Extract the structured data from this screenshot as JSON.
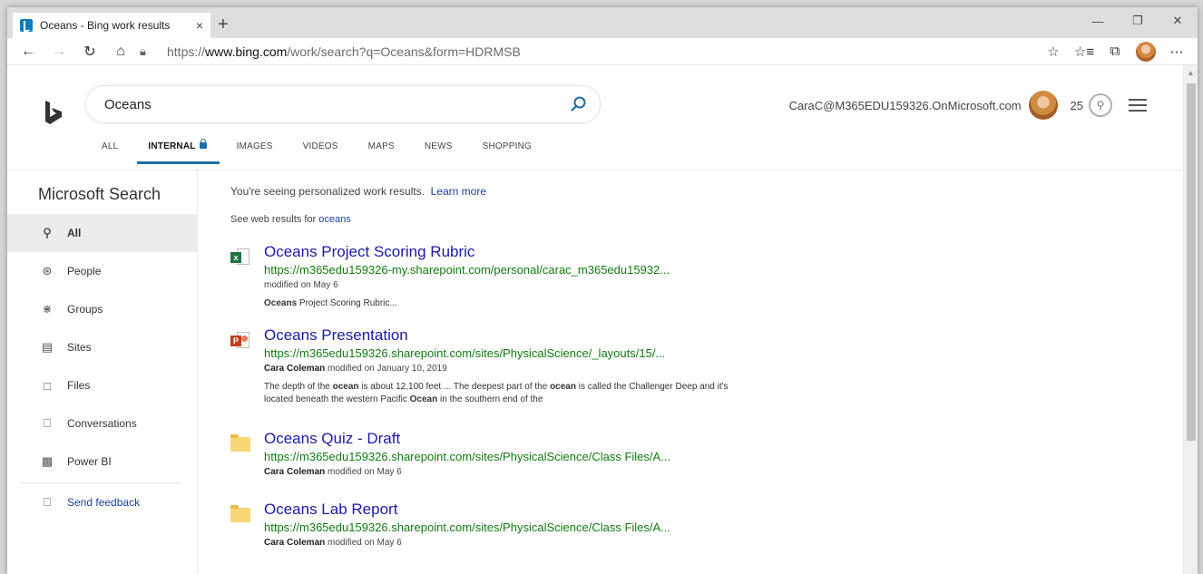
{
  "browser": {
    "tab_title": "Oceans - Bing work results",
    "tab_close": "×",
    "new_tab": "+",
    "url_prefix": "https://",
    "url_host": "www.bing.com",
    "url_path": "/work/search?q=Oceans&form=HDRMSB"
  },
  "header": {
    "search_value": "Oceans",
    "account_email": "CaraC@M365EDU159326.OnMicrosoft.com",
    "reward_points": "25"
  },
  "scopes": [
    {
      "label": "ALL"
    },
    {
      "label": "INTERNAL"
    },
    {
      "label": "IMAGES"
    },
    {
      "label": "VIDEOS"
    },
    {
      "label": "MAPS"
    },
    {
      "label": "NEWS"
    },
    {
      "label": "SHOPPING"
    }
  ],
  "leftnav": {
    "title": "Microsoft Search",
    "items": [
      {
        "label": "All",
        "icon": "search-icon"
      },
      {
        "label": "People",
        "icon": "people-icon"
      },
      {
        "label": "Groups",
        "icon": "groups-icon"
      },
      {
        "label": "Sites",
        "icon": "sites-icon"
      },
      {
        "label": "Files",
        "icon": "files-icon"
      },
      {
        "label": "Conversations",
        "icon": "conversations-icon"
      },
      {
        "label": "Power BI",
        "icon": "power-bi-icon"
      }
    ],
    "feedback": "Send feedback"
  },
  "results_header": {
    "notice": "You're seeing personalized work results.",
    "learn_more": "Learn more",
    "web_prefix": "See web results for",
    "web_query": "oceans"
  },
  "results": [
    {
      "title": "Oceans Project Scoring Rubric",
      "url": "https://m365edu159326-my.sharepoint.com/personal/carac_m365edu15932...",
      "author": "",
      "modified": "modified on May 6",
      "snippet_bold": "Oceans",
      "snippet": " Project Scoring Rubric...",
      "icon": "excel-icon"
    },
    {
      "title": "Oceans Presentation",
      "url": "https://m365edu159326.sharepoint.com/sites/PhysicalScience/_layouts/15/...",
      "author": "Cara Coleman",
      "modified": " modified on January 10, 2019",
      "snippet_html_parts": [
        "The depth of the ",
        "ocean",
        " is about 12,100 feet ... The deepest part of the ",
        "ocean",
        " is called the Challenger Deep and it's located beneath the western Pacific ",
        "Ocean",
        " in the southern end of the"
      ],
      "icon": "powerpoint-icon"
    },
    {
      "title": "Oceans Quiz - Draft",
      "url": "https://m365edu159326.sharepoint.com/sites/PhysicalScience/Class Files/A...",
      "author": "Cara Coleman",
      "modified": " modified on May 6",
      "icon": "folder-icon"
    },
    {
      "title": "Oceans Lab Report",
      "url": "https://m365edu159326.sharepoint.com/sites/PhysicalScience/Class Files/A...",
      "author": "Cara Coleman",
      "modified": " modified on May 6",
      "icon": "folder-icon"
    }
  ],
  "colors": {
    "link": "#1a1aa8",
    "url_green": "#107c10",
    "accent_blue": "#1e6fa8"
  }
}
